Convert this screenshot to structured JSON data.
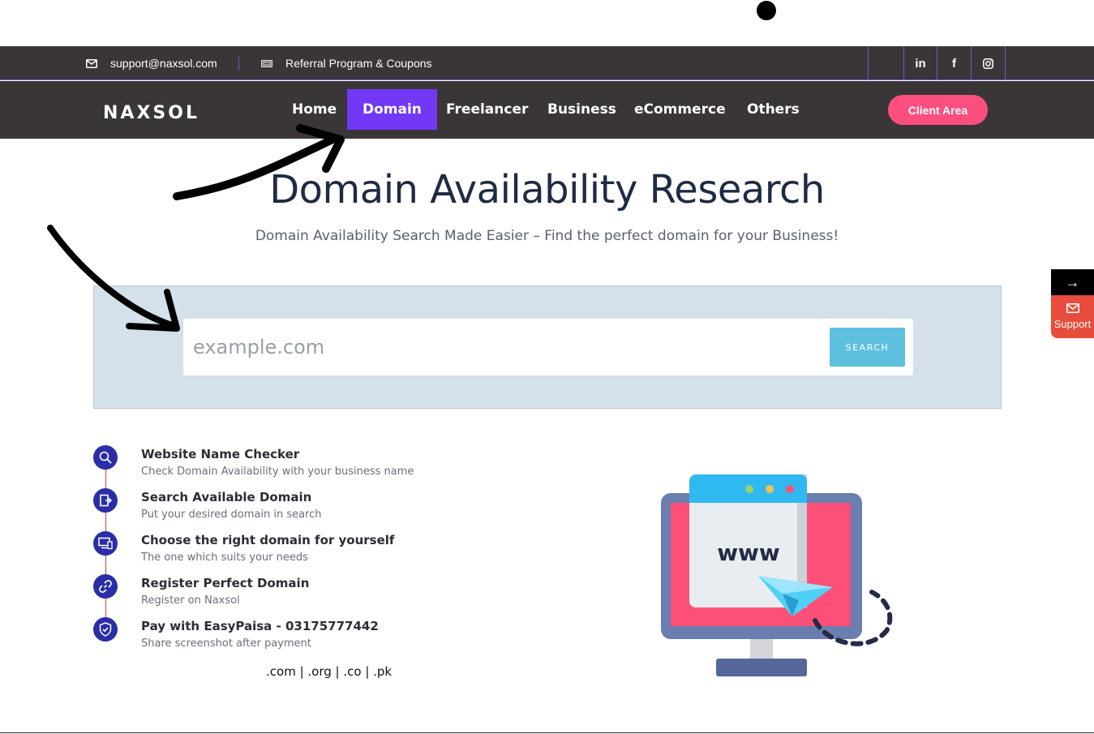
{
  "topbar": {
    "email": "support@naxsol.com",
    "referral": "Referral Program & Coupons",
    "social": [
      {
        "label": "in",
        "icon": "linkedin-icon"
      },
      {
        "label": "f",
        "icon": "facebook-icon"
      },
      {
        "label": "",
        "icon": "instagram-icon"
      }
    ]
  },
  "nav": {
    "logo": "NAXSOL",
    "items": [
      {
        "label": "Home"
      },
      {
        "label": "Domain",
        "active": true
      },
      {
        "label": "Freelancer"
      },
      {
        "label": "Business"
      },
      {
        "label": "eCommerce"
      },
      {
        "label": "Others"
      }
    ],
    "client_area": "Client Area"
  },
  "hero": {
    "title": "Domain Availability Research",
    "subtitle": "Domain Availability Search Made Easier – Find the perfect domain for your Business!"
  },
  "search": {
    "placeholder": "example.com",
    "button": "SEARCH"
  },
  "side_widget": {
    "arrow": "→",
    "support": "Support"
  },
  "steps": [
    {
      "title": "Website Name Checker",
      "desc": "Check Domain Availability with your business name",
      "icon": "search-icon"
    },
    {
      "title": "Search Available Domain",
      "desc": "Put your desired domain in search",
      "icon": "door-icon"
    },
    {
      "title": "Choose the right domain for yourself",
      "desc": "The one which suits your needs",
      "icon": "devices-icon"
    },
    {
      "title": "Register Perfect Domain",
      "desc": "Register on Naxsol",
      "icon": "link-icon"
    },
    {
      "title": "Pay with EasyPaisa - 03175777442",
      "desc": "Share screenshot after payment",
      "icon": "shield-icon"
    }
  ],
  "tlds": ".com | .org | .co | .pk",
  "illustration": {
    "text": "www"
  },
  "colors": {
    "dark_bar": "#3a3637",
    "accent_purple": "#7138f5",
    "client_pink": "#fd4f7f",
    "search_blue": "#5ec0df",
    "step_icon": "#2a2ea6"
  }
}
